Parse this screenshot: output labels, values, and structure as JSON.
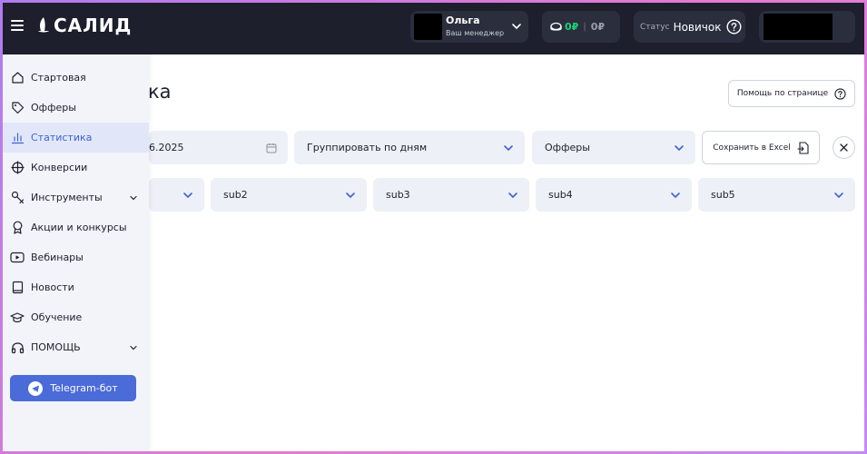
{
  "header": {
    "logo_text": "САЛИД",
    "manager": {
      "name": "Ольга",
      "role": "Ваш менеджер"
    },
    "balance": {
      "available": "0₽",
      "separator": "|",
      "hold": "0₽"
    },
    "status": {
      "label": "Статус",
      "value": "Новичок"
    }
  },
  "main": {
    "title_fragment": "ка",
    "help_label": "Помощь по странице",
    "filters": {
      "date_fragment": "6.2025",
      "group_by": "Группировать по дням",
      "offers": "Офферы",
      "save_excel": "Сохранить в Excel",
      "subs": [
        "",
        "sub2",
        "sub3",
        "sub4",
        "sub5"
      ]
    }
  },
  "sidebar": {
    "items": [
      {
        "label": "Стартовая",
        "icon": "home-icon",
        "active": false
      },
      {
        "label": "Офферы",
        "icon": "tag-icon",
        "active": false
      },
      {
        "label": "Статистика",
        "icon": "bar-chart-icon",
        "active": true
      },
      {
        "label": "Конверсии",
        "icon": "crosshair-icon",
        "active": false
      },
      {
        "label": "Инструменты",
        "icon": "tools-icon",
        "active": false,
        "expandable": true
      },
      {
        "label": "Акции и конкурсы",
        "icon": "award-icon",
        "active": false
      },
      {
        "label": "Вебинары",
        "icon": "play-icon",
        "active": false
      },
      {
        "label": "Новости",
        "icon": "book-icon",
        "active": false
      },
      {
        "label": "Обучение",
        "icon": "graduation-cap-icon",
        "active": false
      },
      {
        "label": "ПОМОЩЬ",
        "icon": "headphones-icon",
        "active": false,
        "expandable": true
      }
    ],
    "telegram_label": "Telegram-бот"
  },
  "colors": {
    "topbar": "#1d1f2d",
    "accent": "#3b62d6",
    "balance_green": "#19d27a",
    "field_bg": "#edf0f7",
    "telegram_button": "#4a6bd8"
  }
}
